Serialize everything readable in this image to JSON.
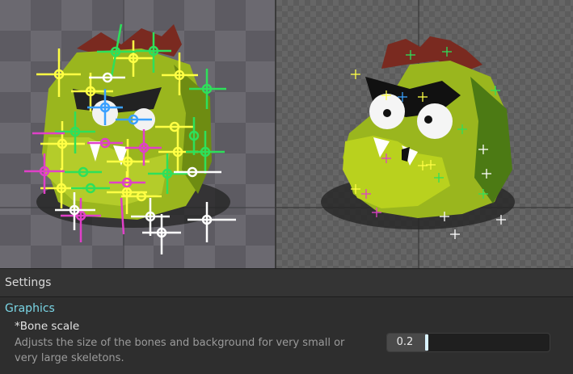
{
  "settings": {
    "title": "Settings",
    "section": "Graphics",
    "bone_scale": {
      "label": "*Bone scale",
      "description": "Adjusts the size of the bones and background for very small or very large skeletons.",
      "value": "0.2",
      "level": 0.25
    }
  },
  "colors": {
    "accent": "#7ad6e6",
    "bone_yellow": "#ffff44",
    "bone_green": "#2ee05a",
    "bone_magenta": "#e040c8",
    "bone_cyan": "#3aa0ff",
    "bone_white": "#ffffff",
    "character_green": "#9ab61e",
    "hair": "#7a2a20"
  }
}
